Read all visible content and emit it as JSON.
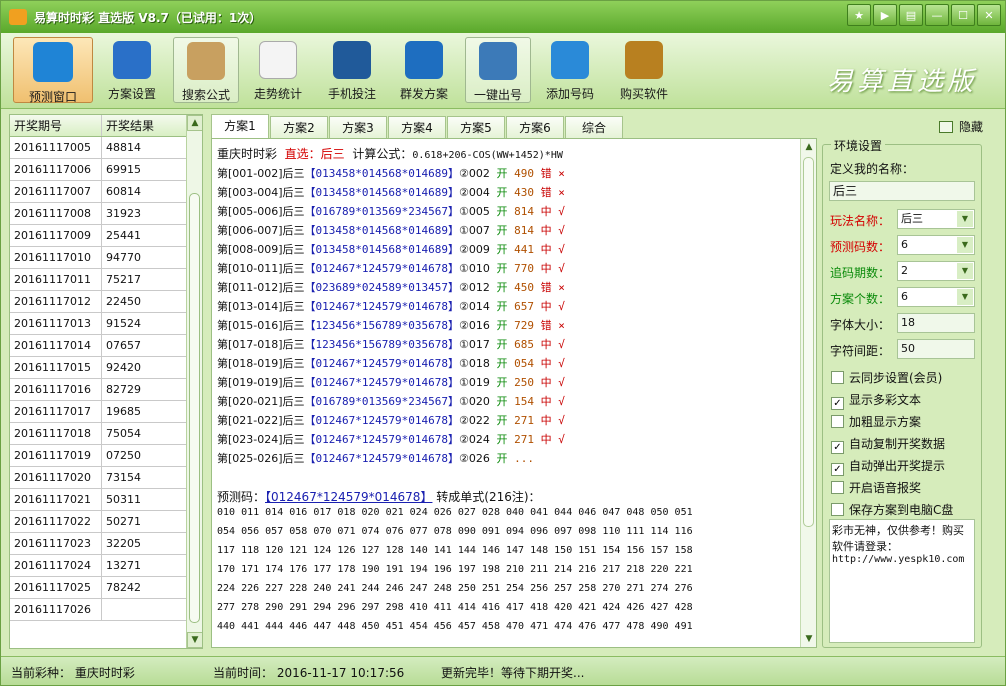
{
  "window": {
    "title": "易算时时彩 直选版 V8.7（已试用：1次）"
  },
  "toolbar": {
    "items": [
      "预测窗口",
      "方案设置",
      "搜索公式",
      "走势统计",
      "手机投注",
      "群发方案",
      "一键出号",
      "添加号码",
      "购买软件"
    ],
    "brand": "易算直选版"
  },
  "left_table": {
    "headers": [
      "开奖期号",
      "开奖结果"
    ],
    "rows": [
      [
        "20161117005",
        "48814"
      ],
      [
        "20161117006",
        "69915"
      ],
      [
        "20161117007",
        "60814"
      ],
      [
        "20161117008",
        "31923"
      ],
      [
        "20161117009",
        "25441"
      ],
      [
        "20161117010",
        "94770"
      ],
      [
        "20161117011",
        "75217"
      ],
      [
        "20161117012",
        "22450"
      ],
      [
        "20161117013",
        "91524"
      ],
      [
        "20161117014",
        "07657"
      ],
      [
        "20161117015",
        "92420"
      ],
      [
        "20161117016",
        "82729"
      ],
      [
        "20161117017",
        "19685"
      ],
      [
        "20161117018",
        "75054"
      ],
      [
        "20161117019",
        "07250"
      ],
      [
        "20161117020",
        "73154"
      ],
      [
        "20161117021",
        "50311"
      ],
      [
        "20161117022",
        "50271"
      ],
      [
        "20161117023",
        "32205"
      ],
      [
        "20161117024",
        "13271"
      ],
      [
        "20161117025",
        "78242"
      ],
      [
        "20161117026",
        ""
      ]
    ]
  },
  "tabs": [
    "方案1",
    "方案2",
    "方案3",
    "方案4",
    "方案5",
    "方案6",
    "综合"
  ],
  "hide_label": "隐藏",
  "main": {
    "header": {
      "lottery": "重庆时时彩",
      "sel_label": "直选：",
      "sel_value": "后三",
      "formula_label": "计算公式：",
      "formula": "0.618+206-COS(WW+1452)*HW"
    },
    "lines": [
      {
        "period": "第[001-002]",
        "pos": "后三",
        "group": "【013458*014568*014689】",
        "idx": "②002",
        "kai": "开",
        "num": "490",
        "res": "错",
        "mark": "×"
      },
      {
        "period": "第[003-004]",
        "pos": "后三",
        "group": "【013458*014568*014689】",
        "idx": "②004",
        "kai": "开",
        "num": "430",
        "res": "错",
        "mark": "×"
      },
      {
        "period": "第[005-006]",
        "pos": "后三",
        "group": "【016789*013569*234567】",
        "idx": "①005",
        "kai": "开",
        "num": "814",
        "res": "中",
        "mark": "√"
      },
      {
        "period": "第[006-007]",
        "pos": "后三",
        "group": "【013458*014568*014689】",
        "idx": "①007",
        "kai": "开",
        "num": "814",
        "res": "中",
        "mark": "√"
      },
      {
        "period": "第[008-009]",
        "pos": "后三",
        "group": "【013458*014568*014689】",
        "idx": "②009",
        "kai": "开",
        "num": "441",
        "res": "中",
        "mark": "√"
      },
      {
        "period": "第[010-011]",
        "pos": "后三",
        "group": "【012467*124579*014678】",
        "idx": "①010",
        "kai": "开",
        "num": "770",
        "res": "中",
        "mark": "√"
      },
      {
        "period": "第[011-012]",
        "pos": "后三",
        "group": "【023689*024589*013457】",
        "idx": "②012",
        "kai": "开",
        "num": "450",
        "res": "错",
        "mark": "×"
      },
      {
        "period": "第[013-014]",
        "pos": "后三",
        "group": "【012467*124579*014678】",
        "idx": "②014",
        "kai": "开",
        "num": "657",
        "res": "中",
        "mark": "√"
      },
      {
        "period": "第[015-016]",
        "pos": "后三",
        "group": "【123456*156789*035678】",
        "idx": "②016",
        "kai": "开",
        "num": "729",
        "res": "错",
        "mark": "×"
      },
      {
        "period": "第[017-018]",
        "pos": "后三",
        "group": "【123456*156789*035678】",
        "idx": "①017",
        "kai": "开",
        "num": "685",
        "res": "中",
        "mark": "√"
      },
      {
        "period": "第[018-019]",
        "pos": "后三",
        "group": "【012467*124579*014678】",
        "idx": "①018",
        "kai": "开",
        "num": "054",
        "res": "中",
        "mark": "√"
      },
      {
        "period": "第[019-019]",
        "pos": "后三",
        "group": "【012467*124579*014678】",
        "idx": "①019",
        "kai": "开",
        "num": "250",
        "res": "中",
        "mark": "√"
      },
      {
        "period": "第[020-021]",
        "pos": "后三",
        "group": "【016789*013569*234567】",
        "idx": "①020",
        "kai": "开",
        "num": "154",
        "res": "中",
        "mark": "√"
      },
      {
        "period": "第[021-022]",
        "pos": "后三",
        "group": "【012467*124579*014678】",
        "idx": "②022",
        "kai": "开",
        "num": "271",
        "res": "中",
        "mark": "√"
      },
      {
        "period": "第[023-024]",
        "pos": "后三",
        "group": "【012467*124579*014678】",
        "idx": "②024",
        "kai": "开",
        "num": "271",
        "res": "中",
        "mark": "√"
      },
      {
        "period": "第[025-026]",
        "pos": "后三",
        "group": "【012467*124579*014678】",
        "idx": "②026",
        "kai": "开",
        "num": "...",
        "res": "",
        "mark": ""
      }
    ],
    "forecast_label": "预测码：",
    "forecast_code": "【012467*124579*014678】",
    "forecast_suffix": "转成单式(216注)：",
    "number_rows": [
      "010 011 014 016 017 018 020 021 024 026 027 028 040 041 044 046 047 048 050 051",
      "054 056 057 058 070 071 074 076 077 078 090 091 094 096 097 098 110 111 114 116",
      "117 118 120 121 124 126 127 128 140 141 144 146 147 148 150 151 154 156 157 158",
      "170 171 174 176 177 178 190 191 194 196 197 198 210 211 214 216 217 218 220 221",
      "224 226 227 228 240 241 244 246 247 248 250 251 254 256 257 258 270 271 274 276",
      "277 278 290 291 294 296 297 298 410 411 414 416 417 418 420 421 424 426 427 428",
      "440 441 444 446 447 448 450 451 454 456 457 458 470 471 474 476 477 478 490 491"
    ]
  },
  "settings": {
    "group_title": "环境设置",
    "name_label": "定义我的名称：",
    "name_value": "后三",
    "play_label": "玩法名称：",
    "play_value": "后三",
    "predict_label": "预测码数：",
    "predict_value": "6",
    "chase_label": "追码期数：",
    "chase_value": "2",
    "count_label": "方案个数：",
    "count_value": "6",
    "font_label": "字体大小：",
    "font_value": "18",
    "spacing_label": "字符间距：",
    "spacing_value": "50",
    "checks": [
      {
        "label": "云同步设置(会员)",
        "checked": false
      },
      {
        "label": "显示多彩文本",
        "checked": true
      },
      {
        "label": "加粗显示方案",
        "checked": false
      },
      {
        "label": "自动复制开奖数据",
        "checked": true
      },
      {
        "label": "自动弹出开奖提示",
        "checked": true
      },
      {
        "label": "开启语音报奖",
        "checked": false
      },
      {
        "label": "保存方案到电脑C盘",
        "checked": false
      }
    ],
    "notice": "彩市无神，仅供参考！购买软件请登录：",
    "url": "http://www.yespk10.com"
  },
  "status": {
    "lottery": "当前彩种：  重庆时时彩",
    "time": "当前时间：  2016-11-17  10:17:56",
    "msg": "更新完毕！等待下期开奖..."
  },
  "colors": {
    "accent": "#5aa82b",
    "red": "#d40000",
    "blue": "#1a20b0",
    "green": "#0a8a0a"
  }
}
